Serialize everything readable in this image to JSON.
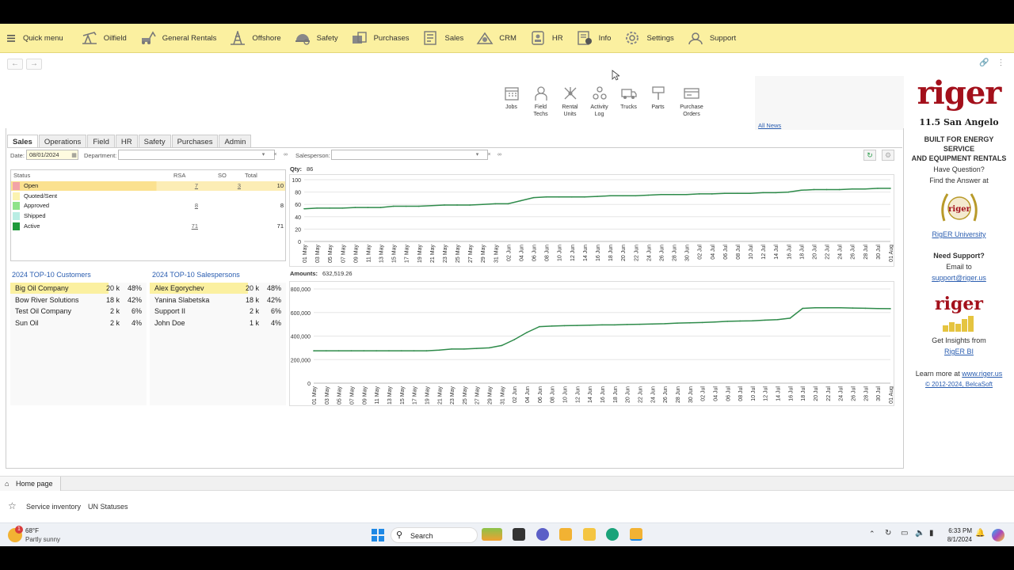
{
  "menu": {
    "items": [
      {
        "label": "Quick menu",
        "icon": "hamburger-icon"
      },
      {
        "label": "Oilfield",
        "icon": "oilpump-icon"
      },
      {
        "label": "General Rentals",
        "icon": "excavator-icon"
      },
      {
        "label": "Offshore",
        "icon": "rig-icon"
      },
      {
        "label": "Safety",
        "icon": "safety-icon"
      },
      {
        "label": "Purchases",
        "icon": "purchases-icon"
      },
      {
        "label": "Sales",
        "icon": "sales-icon"
      },
      {
        "label": "CRM",
        "icon": "crm-icon"
      },
      {
        "label": "HR",
        "icon": "hr-icon"
      },
      {
        "label": "Info",
        "icon": "info-icon"
      },
      {
        "label": "Settings",
        "icon": "gear-icon"
      },
      {
        "label": "Support",
        "icon": "support-icon"
      }
    ]
  },
  "toolbar": {
    "jobs": "Jobs",
    "field_techs": [
      "Field",
      "Techs"
    ],
    "rental_units": [
      "Rental",
      "Units"
    ],
    "activity_log": [
      "Activity",
      "Log"
    ],
    "trucks": "Trucks",
    "parts": "Parts",
    "purchase_orders": [
      "Purchase",
      "Orders"
    ]
  },
  "news": {
    "all_news": "All News"
  },
  "tabs": [
    "Sales",
    "Operations",
    "Field",
    "HR",
    "Safety",
    "Purchases",
    "Admin"
  ],
  "filters": {
    "date_label": "Date:",
    "date_value": "08/01/2024",
    "department_label": "Department:",
    "department_value": "",
    "salesperson_label": "Salesperson:",
    "salesperson_value": ""
  },
  "status_table": {
    "headers": {
      "status": "Status",
      "rsa": "RSA",
      "so": "SO",
      "total": "Total"
    },
    "rows": [
      {
        "label": "Open",
        "rsa": "7",
        "so": "3",
        "total": "10",
        "color": "#f2a3a8"
      },
      {
        "label": "Quoted/Sent",
        "rsa": "",
        "so": "",
        "total": "",
        "color": "#fbf3b0"
      },
      {
        "label": "Approved",
        "rsa": "8",
        "so": "",
        "total": "8",
        "color": "#8fe38a"
      },
      {
        "label": "Shipped",
        "rsa": "",
        "so": "",
        "total": "",
        "color": "#b9ede4"
      },
      {
        "label": "Active",
        "rsa": "71",
        "so": "",
        "total": "71",
        "color": "#1f9a3a"
      }
    ]
  },
  "top_customers": {
    "title": "2024 TOP-10 Customers",
    "rows": [
      {
        "name": "Big Oil Company",
        "amount": "20 k",
        "pct": "48%"
      },
      {
        "name": "Bow River Solutions",
        "amount": "18 k",
        "pct": "42%"
      },
      {
        "name": "Test Oil Company",
        "amount": "2 k",
        "pct": "6%"
      },
      {
        "name": "Sun Oil",
        "amount": "2 k",
        "pct": "4%"
      }
    ]
  },
  "top_salespersons": {
    "title": "2024 TOP-10 Salespersons",
    "rows": [
      {
        "name": "Alex Egorychev",
        "amount": "20 k",
        "pct": "48%"
      },
      {
        "name": "Yanina Slabetska",
        "amount": "18 k",
        "pct": "42%"
      },
      {
        "name": "Support II",
        "amount": "2 k",
        "pct": "6%"
      },
      {
        "name": "John Doe",
        "amount": "1 k",
        "pct": "4%"
      }
    ]
  },
  "qty_caption": {
    "label": "Qty:",
    "value": "86"
  },
  "amount_caption": {
    "label": "Amounts:",
    "value": "632,519.26"
  },
  "chart_data": [
    {
      "type": "line",
      "title": "",
      "color": "#2e8b4a",
      "ylim": [
        0,
        100
      ],
      "yticks": [
        "0",
        "20",
        "40",
        "60",
        "80",
        "100"
      ],
      "x": [
        "01 May",
        "03 May",
        "05 May",
        "07 May",
        "09 May",
        "11 May",
        "13 May",
        "15 May",
        "17 May",
        "19 May",
        "21 May",
        "23 May",
        "25 May",
        "27 May",
        "29 May",
        "31 May",
        "02 Jun",
        "04 Jun",
        "06 Jun",
        "08 Jun",
        "10 Jun",
        "12 Jun",
        "14 Jun",
        "16 Jun",
        "18 Jun",
        "20 Jun",
        "22 Jun",
        "24 Jun",
        "26 Jun",
        "28 Jun",
        "30 Jun",
        "02 Jul",
        "04 Jul",
        "06 Jul",
        "08 Jul",
        "10 Jul",
        "12 Jul",
        "14 Jul",
        "16 Jul",
        "18 Jul",
        "20 Jul",
        "22 Jul",
        "24 Jul",
        "26 Jul",
        "28 Jul",
        "30 Jul",
        "01 Aug"
      ],
      "values": [
        53,
        54,
        54,
        54,
        55,
        55,
        55,
        57,
        57,
        57,
        58,
        59,
        59,
        59,
        60,
        61,
        61,
        66,
        71,
        72,
        72,
        72,
        72,
        73,
        74,
        74,
        74,
        75,
        76,
        76,
        76,
        77,
        77,
        78,
        78,
        78,
        79,
        79,
        80,
        83,
        84,
        84,
        84,
        85,
        85,
        86,
        86
      ]
    },
    {
      "type": "line",
      "title": "",
      "color": "#2e8b4a",
      "ylim": [
        0,
        800000
      ],
      "yticks": [
        "0",
        "200,000",
        "400,000",
        "600,000",
        "800,000"
      ],
      "x": [
        "01 May",
        "03 May",
        "05 May",
        "07 May",
        "09 May",
        "11 May",
        "13 May",
        "15 May",
        "17 May",
        "19 May",
        "21 May",
        "23 May",
        "25 May",
        "27 May",
        "29 May",
        "31 May",
        "02 Jun",
        "04 Jun",
        "06 Jun",
        "08 Jun",
        "10 Jun",
        "12 Jun",
        "14 Jun",
        "16 Jun",
        "18 Jun",
        "20 Jun",
        "22 Jun",
        "24 Jun",
        "26 Jun",
        "28 Jun",
        "30 Jun",
        "02 Jul",
        "04 Jul",
        "06 Jul",
        "08 Jul",
        "10 Jul",
        "12 Jul",
        "14 Jul",
        "16 Jul",
        "18 Jul",
        "20 Jul",
        "22 Jul",
        "24 Jul",
        "26 Jul",
        "28 Jul",
        "30 Jul",
        "01 Aug"
      ],
      "values": [
        275000,
        275000,
        275000,
        275000,
        275000,
        275000,
        275000,
        275000,
        275000,
        275000,
        280000,
        290000,
        290000,
        295000,
        300000,
        320000,
        370000,
        430000,
        480000,
        485000,
        488000,
        490000,
        492000,
        495000,
        495000,
        498000,
        500000,
        502000,
        505000,
        510000,
        512000,
        515000,
        520000,
        525000,
        528000,
        530000,
        535000,
        540000,
        552000,
        635000,
        640000,
        640000,
        640000,
        638000,
        636000,
        634000,
        632519
      ]
    }
  ],
  "right_panel": {
    "logo_text": "riger",
    "sponsor": "11.5 San Angelo",
    "tagline1": "BUILT FOR ENERGY SERVICE",
    "tagline2": "AND EQUIPMENT RENTALS",
    "question": "Have Question?",
    "find_answer": "Find the Answer at",
    "university_link": "RigER University",
    "need_support": "Need Support?",
    "email_to": "Email to",
    "support_email": "support@riger.us",
    "bi_logo_text": "riger",
    "insights": "Get Insights from",
    "bi_link": "RigER BI",
    "learn_more": "Learn more at",
    "website": "www.riger.us",
    "copyright": "© 2012-2024, BelcaSoft"
  },
  "bottom_tab": {
    "label": "Home page"
  },
  "favorites": [
    "Service inventory",
    "UN Statuses"
  ],
  "taskbar": {
    "temp": "68°F",
    "weather": "Partly sunny",
    "search": "Search",
    "time": "6:33 PM",
    "date": "8/1/2024",
    "notif_count": "1"
  }
}
